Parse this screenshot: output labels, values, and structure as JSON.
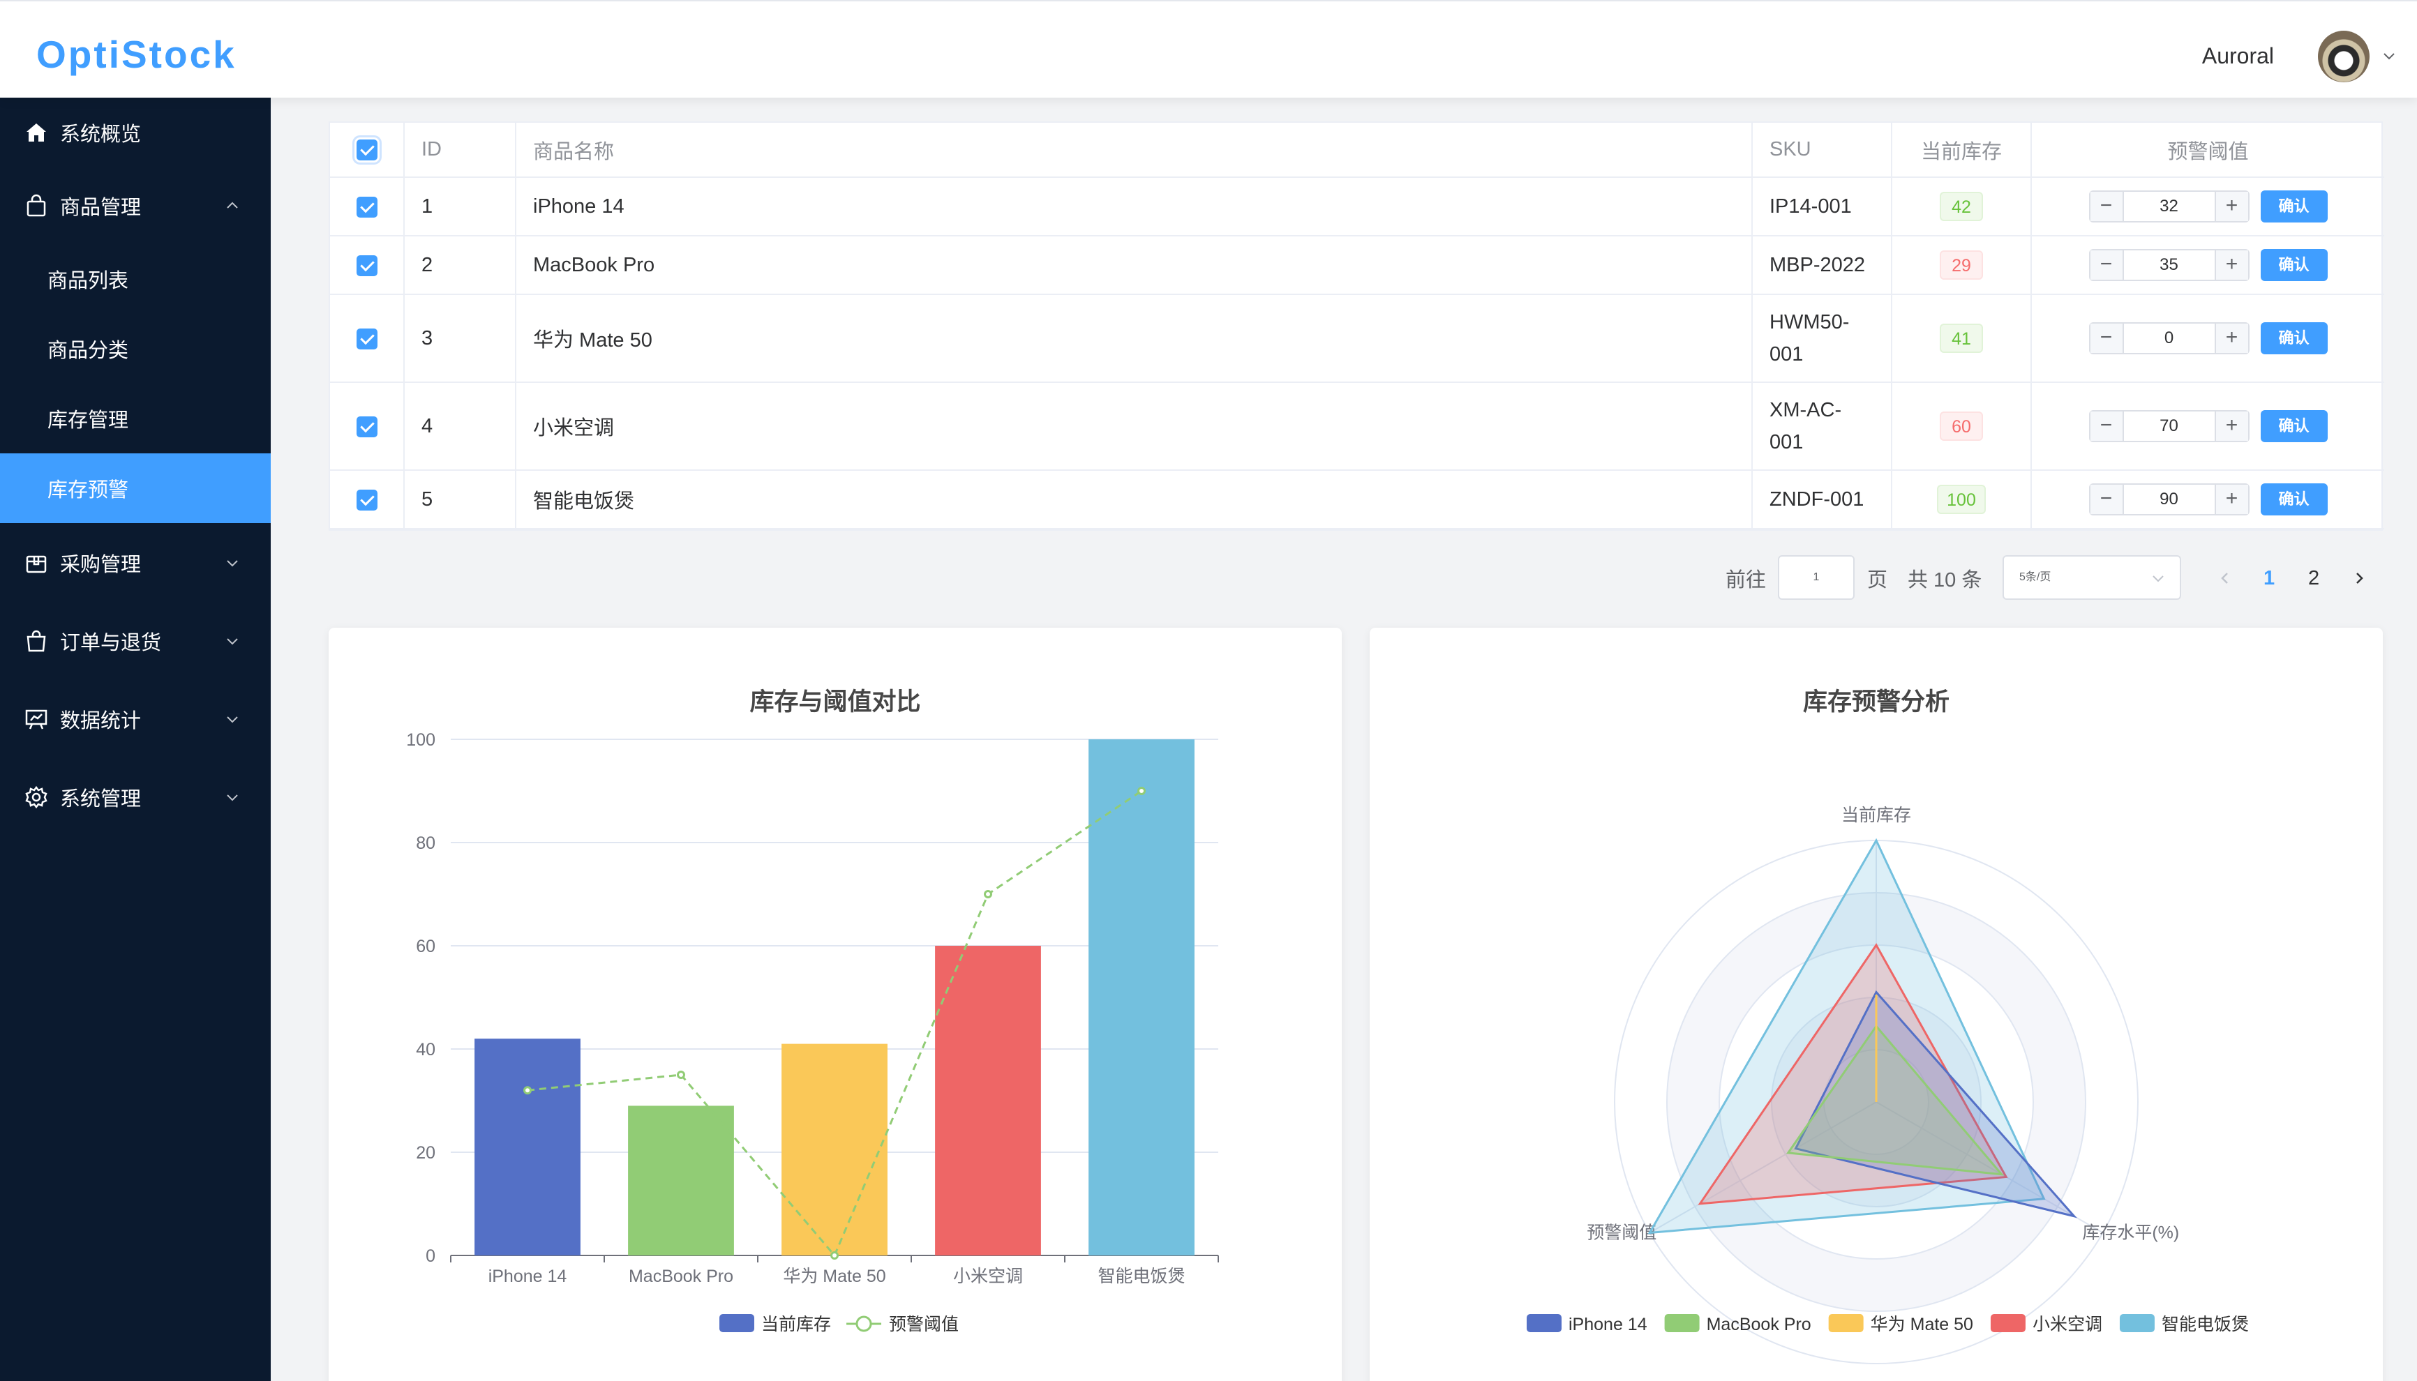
{
  "app": {
    "logo": "OptiStock",
    "user": "Auroral"
  },
  "sidebar": {
    "items": [
      {
        "label": "系统概览",
        "icon": "home-icon"
      },
      {
        "label": "商品管理",
        "icon": "bag-icon",
        "expanded": true,
        "children": [
          "商品列表",
          "商品分类",
          "库存管理",
          "库存预警"
        ]
      },
      {
        "label": "采购管理",
        "icon": "box-icon"
      },
      {
        "label": "订单与退货",
        "icon": "shopping-bag-icon"
      },
      {
        "label": "数据统计",
        "icon": "chart-board-icon"
      },
      {
        "label": "系统管理",
        "icon": "gear-icon"
      }
    ],
    "active": "库存预警"
  },
  "table": {
    "headers": {
      "id": "ID",
      "name": "商品名称",
      "sku": "SKU",
      "stock": "当前库存",
      "threshold": "预警阈值"
    },
    "confirm_label": "确认",
    "rows": [
      {
        "id": "1",
        "name": "iPhone 14",
        "sku": "IP14-001",
        "stock": "42",
        "threshold": "32",
        "status": "ok"
      },
      {
        "id": "2",
        "name": "MacBook Pro",
        "sku": "MBP-2022",
        "stock": "29",
        "threshold": "35",
        "status": "warn"
      },
      {
        "id": "3",
        "name": "华为 Mate 50",
        "sku_lines": [
          "HWM50-",
          "001"
        ],
        "stock": "41",
        "threshold": "0",
        "status": "ok"
      },
      {
        "id": "4",
        "name": "小米空调",
        "sku_lines": [
          "XM-AC-",
          "001"
        ],
        "stock": "60",
        "threshold": "70",
        "status": "warn"
      },
      {
        "id": "5",
        "name": "智能电饭煲",
        "sku": "ZNDF-001",
        "stock": "100",
        "threshold": "90",
        "status": "ok"
      }
    ]
  },
  "pagination": {
    "goto_prefix": "前往",
    "goto_value": "1",
    "goto_suffix": "页",
    "total": "共 10 条",
    "page_size": "5条/页",
    "pages": [
      "1",
      "2"
    ],
    "current": "1"
  },
  "colors": {
    "accent": "#409eff",
    "sidebar_bg": "#0b1a2f",
    "series": [
      "#5470c6",
      "#91cc75",
      "#fac858",
      "#ee6666",
      "#73c0de"
    ]
  },
  "chart_data": [
    {
      "type": "bar",
      "title": "库存与阈值对比",
      "categories": [
        "iPhone 14",
        "MacBook Pro",
        "华为 Mate 50",
        "小米空调",
        "智能电饭煲"
      ],
      "series": [
        {
          "name": "当前库存",
          "type": "bar",
          "values": [
            42,
            29,
            41,
            60,
            100
          ]
        },
        {
          "name": "预警阈值",
          "type": "line",
          "values": [
            32,
            35,
            0,
            70,
            90
          ]
        }
      ],
      "ylim": [
        0,
        100
      ],
      "yticks": [
        "0",
        "20",
        "40",
        "60",
        "80",
        "100"
      ],
      "grid": true,
      "legend": "bottom"
    },
    {
      "type": "radar",
      "title": "库存预警分析",
      "indicators": [
        "当前库存",
        "库存水平(%)",
        "预警阈值"
      ],
      "series": [
        {
          "name": "iPhone 14",
          "values": [
            42,
            131,
            32
          ]
        },
        {
          "name": "MacBook Pro",
          "values": [
            29,
            83,
            35
          ]
        },
        {
          "name": "华为 Mate 50",
          "values": [
            41,
            0,
            0
          ]
        },
        {
          "name": "小米空调",
          "values": [
            60,
            86,
            70
          ]
        },
        {
          "name": "智能电饭煲",
          "values": [
            100,
            111,
            90
          ]
        }
      ],
      "max": [
        100,
        150,
        90
      ],
      "legend": "bottom"
    }
  ]
}
